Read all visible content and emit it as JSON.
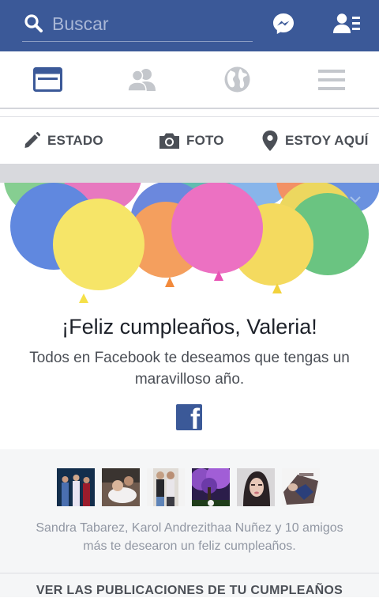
{
  "search": {
    "placeholder": "Buscar"
  },
  "tabs": [
    {
      "name": "news-feed",
      "active": true
    },
    {
      "name": "friends",
      "active": false
    },
    {
      "name": "notifications",
      "active": false
    },
    {
      "name": "more",
      "active": false
    }
  ],
  "composer": {
    "status_label": "ESTADO",
    "photo_label": "FOTO",
    "checkin_label": "ESTOY AQUÍ"
  },
  "birthday": {
    "title": "¡Feliz cumpleaños, Valeria!",
    "message": "Todos en Facebook te deseamos que tengas un maravilloso año."
  },
  "friends_wishes": {
    "text": "Sandra Tabarez, Karol Andrezithaa Nuñez y 10 amigos más te desearon un feliz cumpleaños.",
    "see_posts_label": "VER LAS PUBLICACIONES DE TU CUMPLEAÑOS"
  },
  "colors": {
    "brand": "#3b5998",
    "header_bg": "#3b5998",
    "separator": "#d8d9dd",
    "friends_bg": "#f5f6f7"
  },
  "icons": [
    "search-icon",
    "messenger-icon",
    "friend-requests-icon",
    "news-feed-icon",
    "friends-icon",
    "globe-icon",
    "menu-icon",
    "pencil-icon",
    "camera-icon",
    "location-pin-icon",
    "chevron-down-icon",
    "facebook-logo-icon"
  ]
}
